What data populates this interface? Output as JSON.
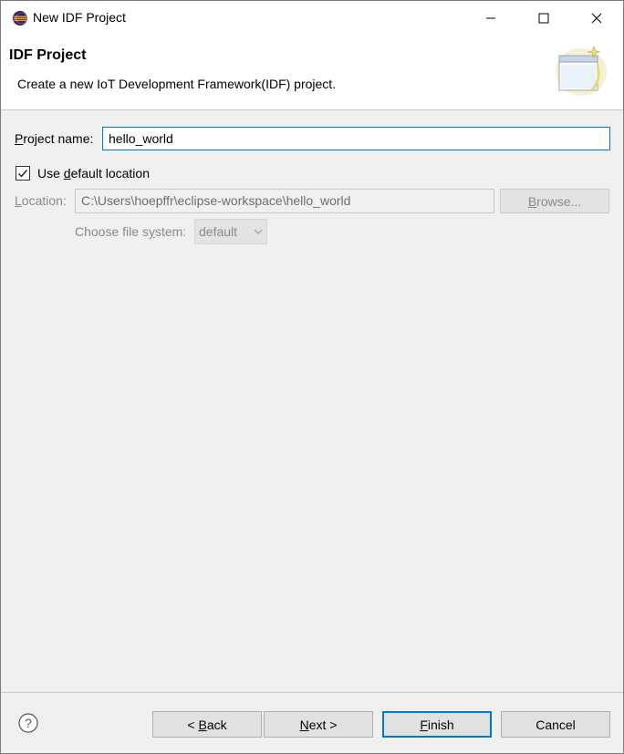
{
  "window": {
    "title": "New IDF Project"
  },
  "banner": {
    "title": "IDF Project",
    "description": "Create a new IoT Development Framework(IDF) project."
  },
  "form": {
    "project_name_label_prefix": "P",
    "project_name_label_rest": "roject name:",
    "project_name_value": "hello_world",
    "use_default_prefix": "Use ",
    "use_default_mnemonic": "d",
    "use_default_rest": "efault location",
    "use_default_checked": true,
    "location_label_prefix": "L",
    "location_label_rest": "ocation:",
    "location_value": "C:\\Users\\hoepffr\\eclipse-workspace\\hello_world",
    "browse_label_prefix": "B",
    "browse_label_rest": "rowse...",
    "fs_label_prefix": "Choose file s",
    "fs_label_mnemonic": "y",
    "fs_label_rest": "stem:",
    "fs_value": "default"
  },
  "buttons": {
    "back_prefix": "< ",
    "back_mnemonic": "B",
    "back_rest": "ack",
    "next_mnemonic": "N",
    "next_rest": "ext >",
    "finish_mnemonic": "F",
    "finish_rest": "inish",
    "cancel": "Cancel"
  },
  "icons": {
    "app": "eclipse-icon",
    "help": "help-icon",
    "minimize": "minimize-icon",
    "maximize": "maximize-icon",
    "close": "close-icon",
    "checkbox": "checkmark-icon",
    "dropdown": "chevron-down-icon",
    "banner": "new-project-wizard-icon"
  },
  "colors": {
    "accent": "#0078d7",
    "dialog_bg": "#f0f0f0",
    "disabled_text": "#8a8a8a"
  }
}
